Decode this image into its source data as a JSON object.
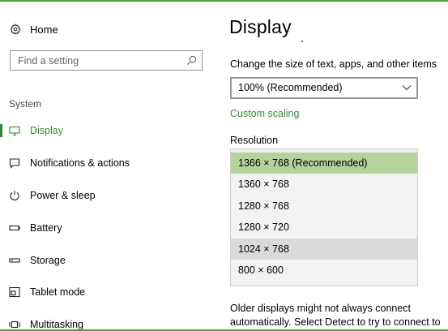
{
  "nav": {
    "home_label": "Home",
    "search_placeholder": "Find a setting",
    "section_label": "System",
    "items": [
      {
        "label": "Display",
        "icon": "monitor-icon",
        "active": true
      },
      {
        "label": "Notifications & actions",
        "icon": "notification-icon",
        "active": false
      },
      {
        "label": "Power & sleep",
        "icon": "power-icon",
        "active": false
      },
      {
        "label": "Battery",
        "icon": "battery-icon",
        "active": false
      },
      {
        "label": "Storage",
        "icon": "storage-icon",
        "active": false
      },
      {
        "label": "Tablet mode",
        "icon": "tablet-mode-icon",
        "active": false
      },
      {
        "label": "Multitasking",
        "icon": "multitasking-icon",
        "active": false
      }
    ]
  },
  "main": {
    "title": "Display",
    "scale_label": "Change the size of text, apps, and other items",
    "scale_value": "100% (Recommended)",
    "custom_scaling": "Custom scaling",
    "resolution_label": "Resolution",
    "resolution_options": [
      {
        "label": "1366 × 768 (Recommended)",
        "state": "selected"
      },
      {
        "label": "1360 × 768",
        "state": "normal"
      },
      {
        "label": "1280 × 768",
        "state": "normal"
      },
      {
        "label": "1280 × 720",
        "state": "normal"
      },
      {
        "label": "1024 × 768",
        "state": "hover"
      },
      {
        "label": "800 × 600",
        "state": "normal"
      }
    ],
    "note_line1": "Older displays might not always connect",
    "note_line2": "automatically. Select Detect to try to connect to"
  },
  "colors": {
    "accent": "#318c31",
    "selected_row": "#b4d39a",
    "hover_row": "#dadada",
    "accent_border": "#52a33d"
  }
}
